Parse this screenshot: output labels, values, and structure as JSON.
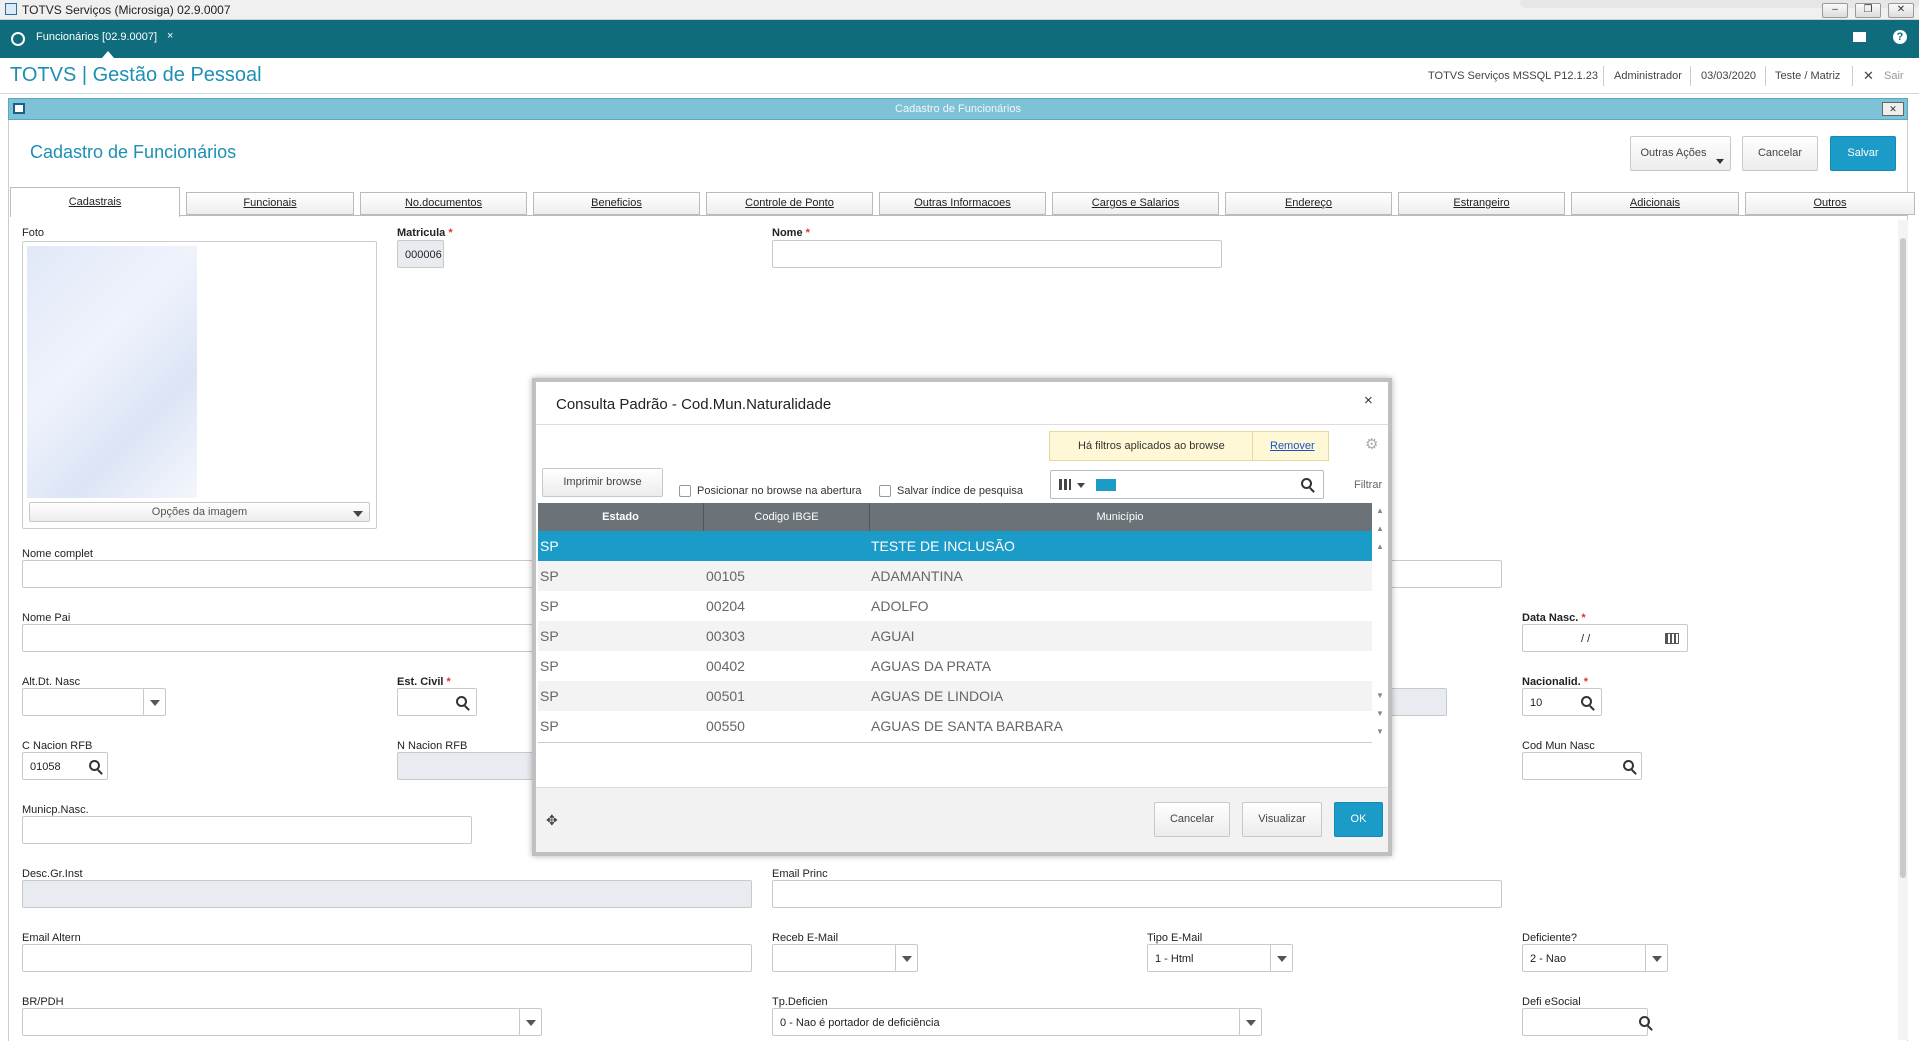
{
  "window": {
    "title": "TOTVS Serviços (Microsiga) 02.9.0007",
    "tab": "Funcionários [02.9.0007]"
  },
  "header": {
    "brand": "TOTVS | Gestão de Pessoal",
    "env": "TOTVS Serviços MSSQL P12.1.23",
    "user": "Administrador",
    "date": "03/03/2020",
    "company": "Teste / Matriz",
    "exit": "Sair"
  },
  "mdi": {
    "title": "Cadastro de Funcionários"
  },
  "page": {
    "title": "Cadastro de Funcionários",
    "other_actions": "Outras Ações",
    "cancel": "Cancelar",
    "save": "Salvar"
  },
  "tabs": [
    "Cadastrais",
    "Funcionais",
    "No.documentos",
    "Beneficios",
    "Controle de Ponto",
    "Outras Informacoes",
    "Cargos e Salarios",
    "Endereço",
    "Estrangeiro",
    "Adicionais",
    "Outros"
  ],
  "form": {
    "foto": "Foto",
    "image_options": "Opções da imagem",
    "matricula_lbl": "Matricula",
    "matricula": "000006",
    "nome_lbl": "Nome",
    "nome_complet": "Nome complet",
    "nome_pai": "Nome Pai",
    "data_nasc_lbl": "Data Nasc.",
    "data_nasc": "/ /",
    "alt_dt_nasc": "Alt.Dt. Nasc",
    "est_civil": "Est. Civil",
    "nacionalid_lbl": "Nacionalid.",
    "nacionalid": "10",
    "c_nacion_lbl": "C Nacion RFB",
    "c_nacion": "01058",
    "n_nacion": "N Nacion RFB",
    "cod_mun_nasc": "Cod Mun Nasc",
    "municp_nasc": "Municp.Nasc.",
    "desc_gr_inst": "Desc.Gr.Inst",
    "email_princ": "Email Princ",
    "email_altern": "Email Altern",
    "receb_email": "Receb E-Mail",
    "tipo_email_lbl": "Tipo E-Mail",
    "tipo_email": "1 - Html",
    "deficiente_lbl": "Deficiente?",
    "deficiente": "2 - Nao",
    "br_pdh": "BR/PDH",
    "tp_deficien_lbl": "Tp.Deficien",
    "tp_deficien": "0 - Nao é portador de deficiência",
    "defi_esocial": "Defi eSocial"
  },
  "dialog": {
    "title": "Consulta Padrão - Cod.Mun.Naturalidade",
    "filter_notice": "Há filtros aplicados ao browse",
    "remove": "Remover",
    "print": "Imprimir browse",
    "chk_position": "Posicionar no browse na abertura",
    "chk_save_index": "Salvar índice de pesquisa",
    "filter": "Filtrar",
    "columns": [
      "Estado",
      "Codigo IBGE",
      "Município"
    ],
    "rows": [
      [
        "SP",
        "",
        "TESTE DE INCLUSÃO"
      ],
      [
        "SP",
        "00105",
        "ADAMANTINA"
      ],
      [
        "SP",
        "00204",
        "ADOLFO"
      ],
      [
        "SP",
        "00303",
        "AGUAI"
      ],
      [
        "SP",
        "00402",
        "AGUAS DA PRATA"
      ],
      [
        "SP",
        "00501",
        "AGUAS DE LINDOIA"
      ],
      [
        "SP",
        "00550",
        "AGUAS DE SANTA BARBARA"
      ]
    ],
    "cancel": "Cancelar",
    "view": "Visualizar",
    "ok": "OK"
  },
  "colors": {
    "accent": "#1b9bc7",
    "topbar": "#0f6c7c",
    "grid_header": "#6b7378"
  }
}
